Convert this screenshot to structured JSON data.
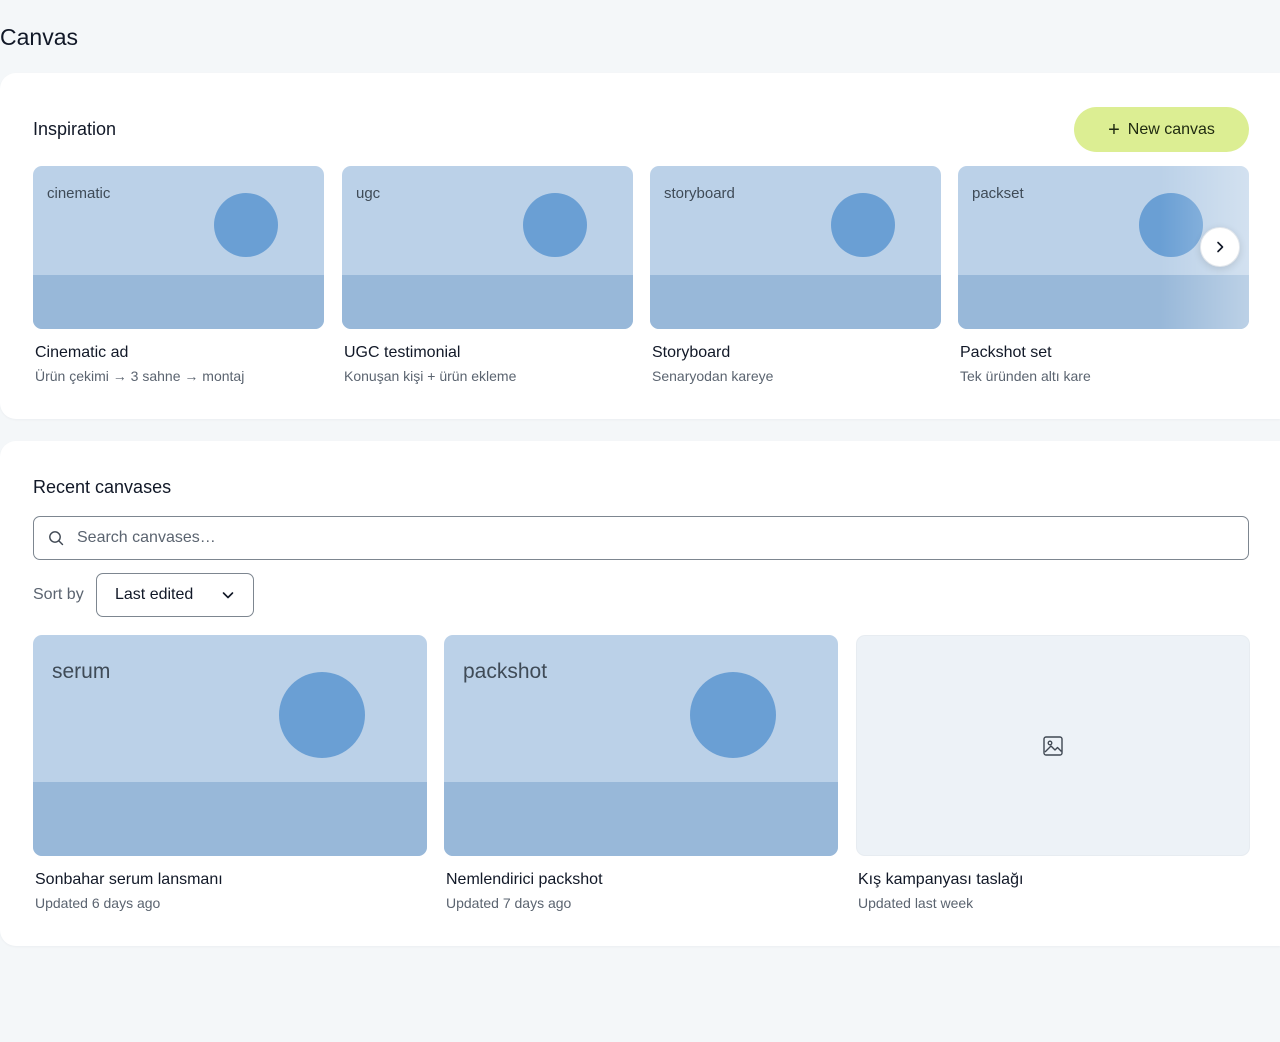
{
  "page": {
    "title": "Canvas"
  },
  "inspiration": {
    "title": "Inspiration",
    "new_canvas_label": "New canvas",
    "cards": [
      {
        "tag": "cinematic",
        "title": "Cinematic ad",
        "subtitle": "Ürün çekimi → 3 sahne → montaj"
      },
      {
        "tag": "ugc",
        "title": "UGC testimonial",
        "subtitle": "Konuşan kişi + ürün ekleme"
      },
      {
        "tag": "storyboard",
        "title": "Storyboard",
        "subtitle": "Senaryodan kareye"
      },
      {
        "tag": "packset",
        "title": "Packshot set",
        "subtitle": "Tek üründen altı kare"
      }
    ]
  },
  "recent": {
    "title": "Recent canvases",
    "search": {
      "placeholder": "Search canvases…",
      "value": ""
    },
    "sort": {
      "label": "Sort by",
      "selected": "Last edited"
    },
    "cards": [
      {
        "tag": "serum",
        "title": "Sonbahar serum lansmanı",
        "updated": "Updated 6 days ago"
      },
      {
        "tag": "packshot",
        "title": "Nemlendirici packshot",
        "updated": "Updated 7 days ago"
      },
      {
        "tag": "",
        "title": "Kış kampanyası taslağı",
        "updated": "Updated last week"
      }
    ]
  },
  "colors": {
    "accent": "#dcee93",
    "thumb_sky": "#bbd1e8",
    "thumb_ground": "#98b8d9",
    "thumb_sun": "#6a9fd4",
    "placeholder_bg": "#edf2f7"
  },
  "icons": {
    "new_canvas": "plus-icon",
    "carousel_next": "chevron-right-icon",
    "search": "search-icon",
    "sort": "chevron-down-icon",
    "empty_thumbnail": "image-icon"
  }
}
